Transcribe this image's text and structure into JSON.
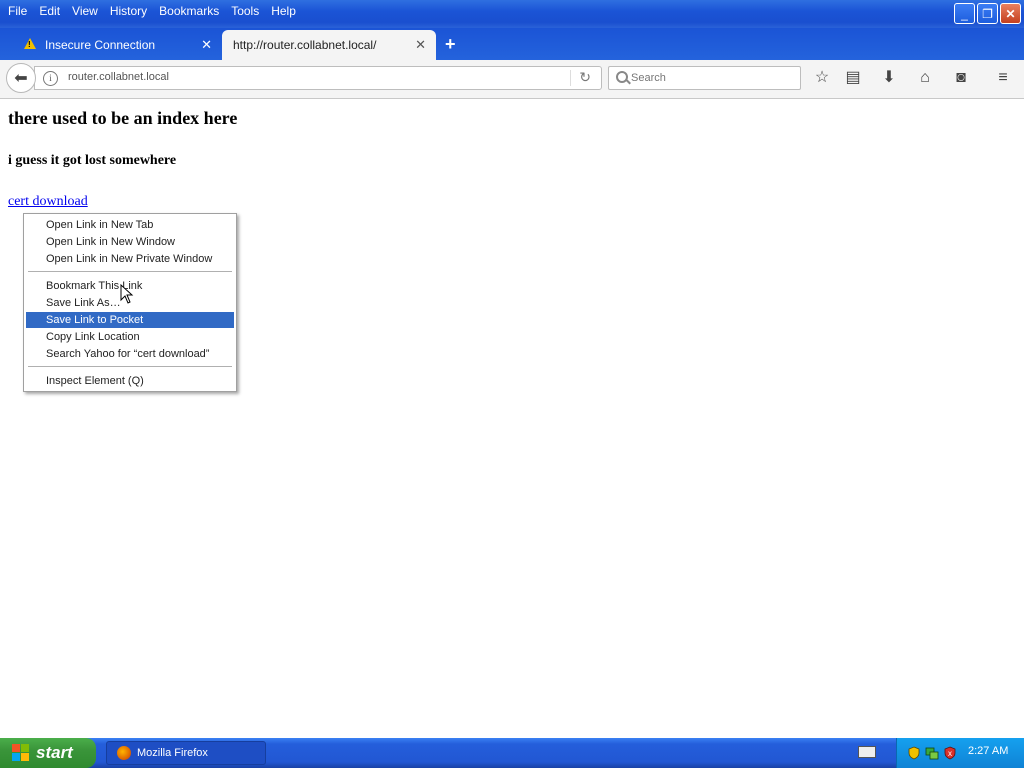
{
  "menubar": {
    "items": [
      "File",
      "Edit",
      "View",
      "History",
      "Bookmarks",
      "Tools",
      "Help"
    ]
  },
  "tabs": [
    {
      "label": "Insecure Connection"
    },
    {
      "label": "http://router.collabnet.local/"
    }
  ],
  "navbar": {
    "url": "router.collabnet.local",
    "search_placeholder": "Search"
  },
  "page": {
    "heading": "there used to be an index here",
    "subheading": "i guess it got lost somewhere",
    "link": "cert download"
  },
  "context_menu": {
    "items": [
      "Open Link in New Tab",
      "Open Link in New Window",
      "Open Link in New Private Window",
      "Bookmark This Link",
      "Save Link As…",
      "Save Link to Pocket",
      "Copy Link Location",
      "Search Yahoo for “cert download”",
      "Inspect Element (Q)"
    ],
    "highlighted": "Save Link to Pocket"
  },
  "taskbar": {
    "start_label": "start",
    "task_label": "Mozilla Firefox",
    "clock": "2:27 AM"
  },
  "colors": {
    "titlebar": "#1b54d6",
    "menu_highlight": "#316ac5",
    "link": "#0000ee",
    "start_green": "#3a953a"
  }
}
